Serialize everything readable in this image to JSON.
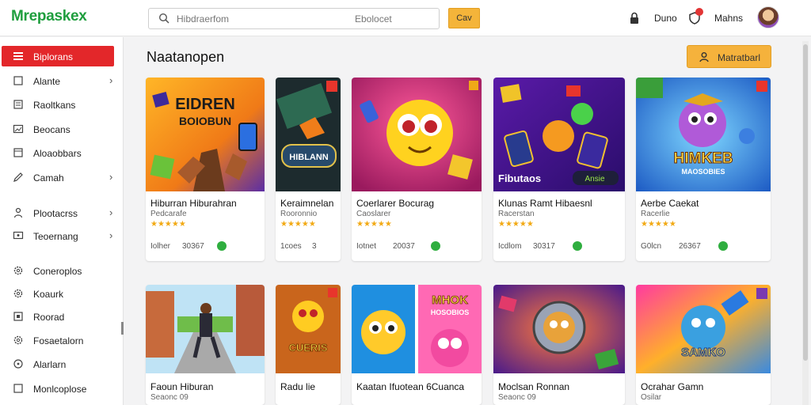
{
  "header": {
    "logo": "Mrepaskex",
    "search_placeholder": "Hibdraerfom",
    "search_hint": "Ebolocet",
    "search_button": "Cav",
    "user_link": "Duno",
    "username": "Mahns"
  },
  "sidebar": {
    "items": [
      {
        "label": "Biplorans",
        "icon": "menu-icon",
        "active": true
      },
      {
        "label": "Alante",
        "icon": "square-icon",
        "chevron": true
      },
      {
        "label": "Raoltkans",
        "icon": "list-icon"
      },
      {
        "label": "Beocans",
        "icon": "image-icon"
      },
      {
        "label": "Aloaobbars",
        "icon": "window-icon"
      },
      {
        "label": "Camah",
        "icon": "pencil-icon",
        "chevron": true
      },
      {
        "label": "Plootacrss",
        "icon": "person-icon",
        "chevron": true
      },
      {
        "label": "Teoernang",
        "icon": "display-icon",
        "chevron": true
      },
      {
        "label": "Coneroplos",
        "icon": "gear-icon"
      },
      {
        "label": "Koaurk",
        "icon": "cog-icon"
      },
      {
        "label": "Roorad",
        "icon": "box-icon"
      },
      {
        "label": "Fosaetalorn",
        "icon": "settings-icon"
      },
      {
        "label": "Alarlarn",
        "icon": "circle-icon"
      },
      {
        "label": "Monlcoplose",
        "icon": "square-icon"
      }
    ]
  },
  "main": {
    "title": "Naatanopen",
    "action_button": "Matratbarl",
    "row1": [
      {
        "name": "Hiburran Hiburahran",
        "sub": "Pedcarafe",
        "stars": "★★★★★",
        "meta": "Iolher",
        "count": "30367"
      },
      {
        "name": "Keraimnelan",
        "sub": "Rooronnio",
        "stars": "★★★★★",
        "meta": "1coes",
        "count": "3"
      },
      {
        "name": "Coerlarer Bocurag",
        "sub": "Caoslarer",
        "stars": "★★★★★",
        "meta": "Iotnet",
        "count": "20037"
      },
      {
        "name": "Klunas Ramt Hibaesnl",
        "sub": "Racerstan",
        "stars": "★★★★★",
        "meta": "Icdlom",
        "count": "30317"
      },
      {
        "name": "Aerbe Caekat",
        "sub": "Racerlie",
        "stars": "★★★★★",
        "meta": "G0lcn",
        "count": "26367"
      }
    ],
    "row2": [
      {
        "name": "Faoun Hiburan",
        "sub": "Seaonc 09"
      },
      {
        "name": "Radu lie"
      },
      {
        "name": "Kaatan Ifuotean 6Cuanca"
      },
      {
        "name": "Moclsan Ronnan",
        "sub": "Seaonc 09"
      },
      {
        "name": "Ocrahar Gamn",
        "sub": "Osilar"
      }
    ],
    "thumb_texts": {
      "t1": "EIDREN",
      "t1b": "BOIOBUN",
      "t2": "HIBLANN",
      "t4": "Fibutaos",
      "t4b": "Ansie",
      "t5": "HIMKEB",
      "t5b": "MAOSOBIES",
      "t6": "MHOK",
      "t6b": "HOSOBIOS",
      "t7": "SAMKO",
      "t8": "CUERIS"
    }
  }
}
